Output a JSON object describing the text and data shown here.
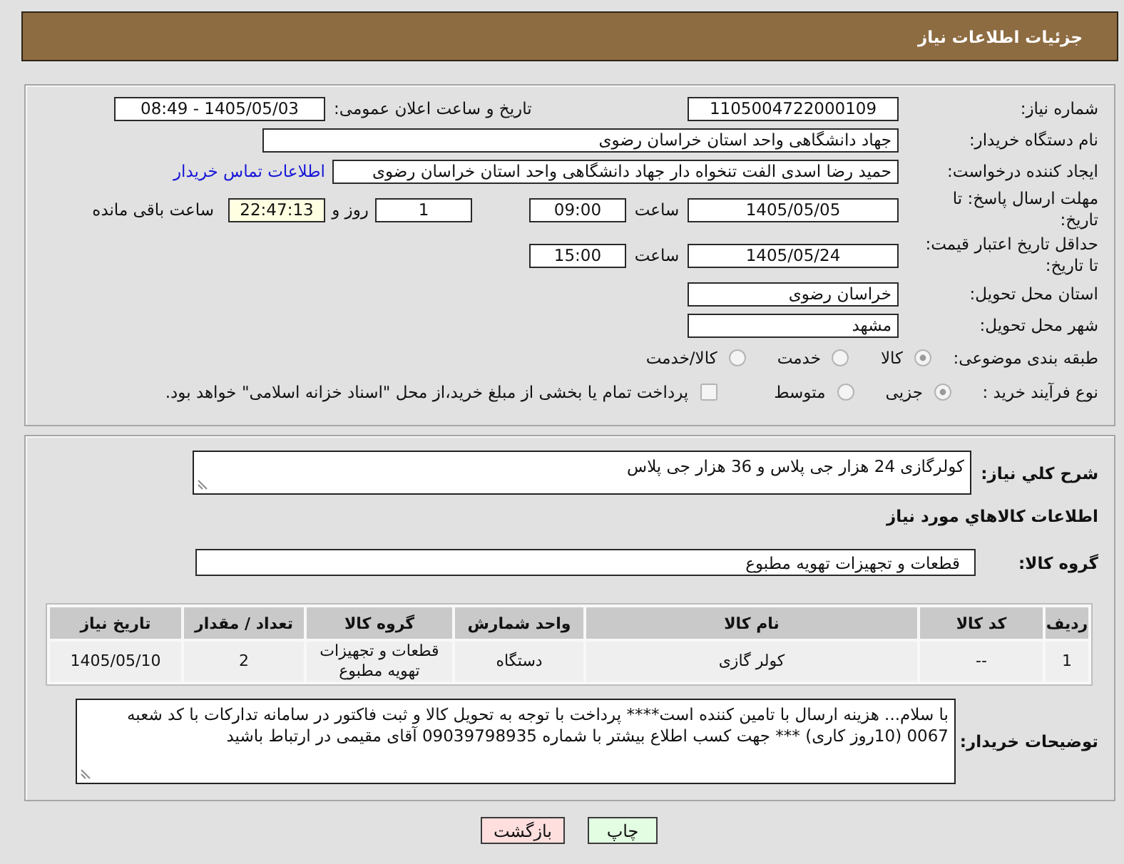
{
  "header": {
    "title": "جزئیات اطلاعات نیاز"
  },
  "details": {
    "need_number": {
      "label": "شماره نیاز:",
      "value": "1105004722000109"
    },
    "announcement": {
      "label": "تاریخ و ساعت اعلان عمومی:",
      "value": "1405/05/03 - 08:49"
    },
    "buyer_org": {
      "label": "نام دستگاه خریدار:",
      "value": "جهاد دانشگاهی واحد استان خراسان رضوی"
    },
    "requester": {
      "label": "ایجاد کننده درخواست:",
      "value": "حمید رضا اسدی الفت تنخواه دار جهاد دانشگاهی واحد استان خراسان رضوی",
      "contact_link": "اطلاعات تماس خریدار"
    },
    "response_deadline": {
      "label": "مهلت ارسال پاسخ: تا تاریخ:",
      "date": "1405/05/05",
      "time_label": "ساعت",
      "time": "09:00",
      "days": "1",
      "days_label": "روز و",
      "remaining": "22:47:13",
      "remaining_label": "ساعت باقی مانده"
    },
    "price_validity": {
      "label": "حداقل تاریخ اعتبار قیمت: تا تاریخ:",
      "date": "1405/05/24",
      "time_label": "ساعت",
      "time": "15:00"
    },
    "delivery_province": {
      "label": "استان محل تحویل:",
      "value": "خراسان رضوی"
    },
    "delivery_city": {
      "label": "شهر محل تحویل:",
      "value": "مشهد"
    },
    "subject_category": {
      "label": "طبقه بندی موضوعی:",
      "options": [
        {
          "label": "کالا",
          "selected": true
        },
        {
          "label": "خدمت",
          "selected": false
        },
        {
          "label": "کالا/خدمت",
          "selected": false
        }
      ]
    },
    "purchase_process": {
      "label": "نوع فرآیند خرید :",
      "options": [
        {
          "label": "جزیی",
          "selected": true
        },
        {
          "label": "متوسط",
          "selected": false
        }
      ],
      "treasury_payment": {
        "label": "پرداخت تمام یا بخشی از مبلغ خرید،از محل \"اسناد خزانه اسلامی\" خواهد بود.",
        "checked": false
      }
    }
  },
  "description": {
    "label": "شرح کلي نياز:",
    "value": "کولرگازی 24 هزار جی پلاس و 36 هزار جی پلاس"
  },
  "goods": {
    "heading": "اطلاعات کالاهاي مورد نياز",
    "group_label": "گروه کالا:",
    "group_value": "قطعات و تجهیزات تهویه مطبوع",
    "table": {
      "columns": [
        "ردیف",
        "کد کالا",
        "نام کالا",
        "واحد شمارش",
        "گروه کالا",
        "تعداد / مقدار",
        "تاریخ نیاز"
      ],
      "rows": [
        [
          "1",
          "--",
          "کولر گازی",
          "دستگاه",
          "قطعات و تجهیزات تهویه مطبوع",
          "2",
          "1405/05/10"
        ]
      ]
    }
  },
  "buyer_notes": {
    "label": "توضیحات خریدار:",
    "value": "با سلام... هزینه ارسال با تامین کننده است**** پرداخت با توجه به تحویل کالا و ثبت فاکتور در سامانه تدارکات با کد شعبه 0067 (10روز کاری) *** جهت کسب اطلاع بیشتر با شماره 09039798935 آقای مقیمی در ارتباط باشید"
  },
  "buttons": [
    {
      "label": "چاپ",
      "kind": "print"
    },
    {
      "label": "بازگشت",
      "kind": "back"
    }
  ]
}
